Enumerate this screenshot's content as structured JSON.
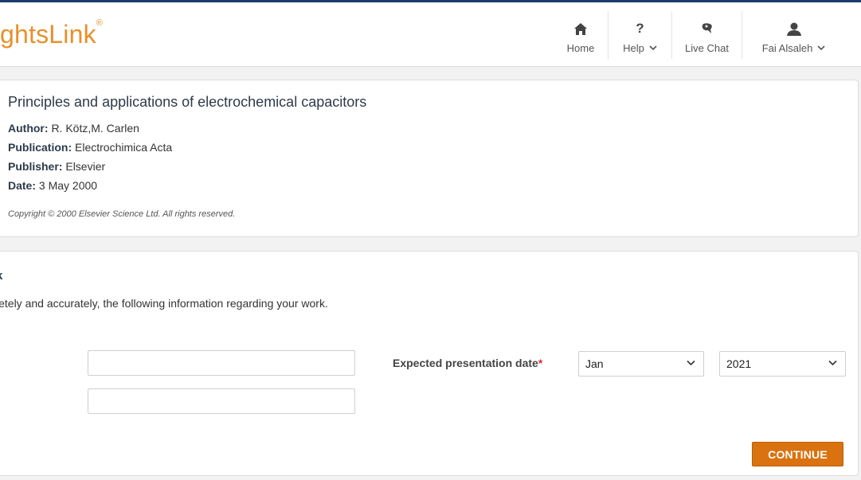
{
  "header": {
    "logo_text": "ghtsLink",
    "logo_mark": "®",
    "nav": {
      "home": {
        "label": "Home",
        "icon": "home-icon"
      },
      "help": {
        "label": "Help",
        "icon": "question-icon"
      },
      "chat": {
        "label": "Live Chat",
        "icon": "chat-icon"
      },
      "user": {
        "label": "Fai Alsaleh",
        "icon": "user-icon"
      }
    }
  },
  "article": {
    "title": "Principles and applications of electrochemical capacitors",
    "author_label": "Author:",
    "author": "R. Kötz,M. Carlen",
    "publication_label": "Publication:",
    "publication": "Electrochimica Acta",
    "publisher_label": "Publisher:",
    "publisher": "Elsevier",
    "date_label": "Date:",
    "date": "3 May 2000",
    "copyright": "Copyright © 2000 Elsevier Science Ltd. All rights reserved."
  },
  "form": {
    "section_title": "k",
    "description": "letely and accurately, the following information regarding your work.",
    "input1_value": "",
    "input2_value": "",
    "date_label": "Expected presentation date",
    "required_mark": "*",
    "month_value": "Jan",
    "year_value": "2021",
    "continue_label": "CONTINUE"
  },
  "colors": {
    "brand_orange": "#e8902b",
    "button_orange": "#d9720f",
    "top_bar": "#1b3b6f"
  }
}
